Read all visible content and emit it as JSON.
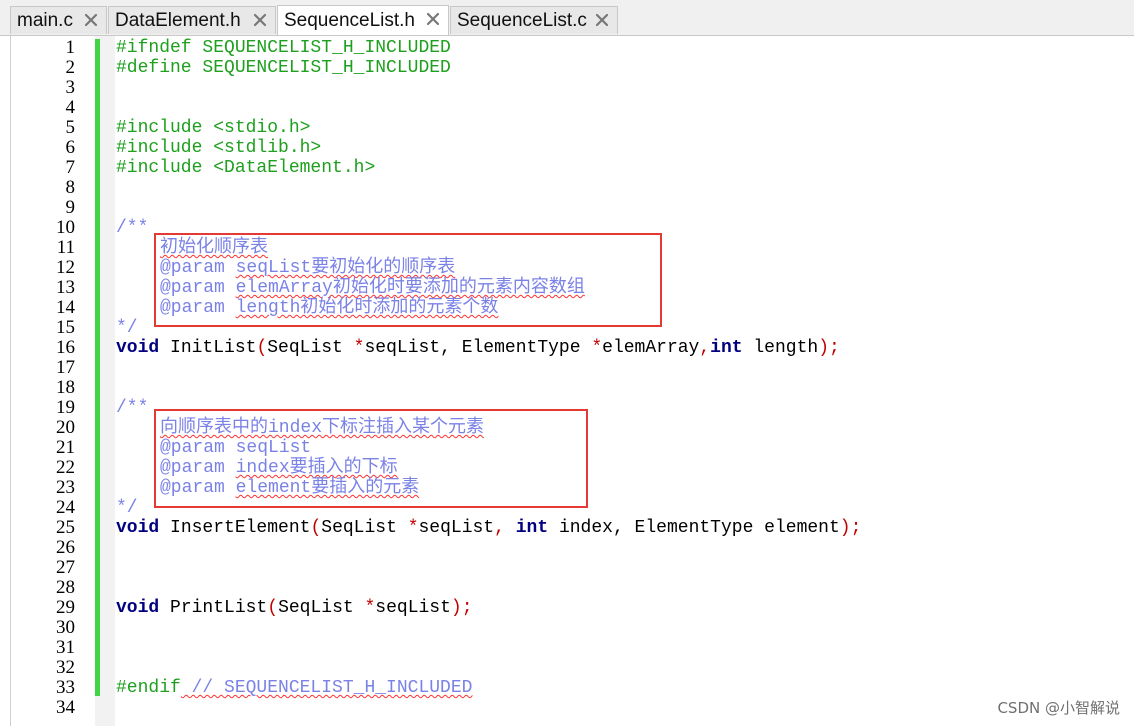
{
  "tabs": [
    {
      "label": "main.c",
      "active": false
    },
    {
      "label": "DataElement.h",
      "active": false
    },
    {
      "label": "SequenceList.h",
      "active": true
    },
    {
      "label": "SequenceList.c",
      "active": false
    }
  ],
  "tab_close_icon": "close-icon",
  "editor": {
    "lines": [
      {
        "n": "1"
      },
      {
        "n": "2"
      },
      {
        "n": "3"
      },
      {
        "n": "4"
      },
      {
        "n": "5"
      },
      {
        "n": "6"
      },
      {
        "n": "7"
      },
      {
        "n": "8"
      },
      {
        "n": "9"
      },
      {
        "n": "10"
      },
      {
        "n": "11"
      },
      {
        "n": "12"
      },
      {
        "n": "13"
      },
      {
        "n": "14"
      },
      {
        "n": "15"
      },
      {
        "n": "16"
      },
      {
        "n": "17"
      },
      {
        "n": "18"
      },
      {
        "n": "19"
      },
      {
        "n": "20"
      },
      {
        "n": "21"
      },
      {
        "n": "22"
      },
      {
        "n": "23"
      },
      {
        "n": "24"
      },
      {
        "n": "25"
      },
      {
        "n": "26"
      },
      {
        "n": "27"
      },
      {
        "n": "28"
      },
      {
        "n": "29"
      },
      {
        "n": "30"
      },
      {
        "n": "31"
      },
      {
        "n": "32"
      },
      {
        "n": "33"
      },
      {
        "n": "34"
      }
    ],
    "code": {
      "l1": "#ifndef SEQUENCELIST_H_INCLUDED",
      "l2": "#define SEQUENCELIST_H_INCLUDED",
      "l5": "#include <stdio.h>",
      "l6": "#include <stdlib.h>",
      "l7": "#include <DataElement.h>",
      "l10": "/**",
      "l11": "初始化顺序表",
      "l12_tag": "@param ",
      "l12_txt": "seqList要初始化的顺序表",
      "l13_tag": "@param ",
      "l13_txt": "elemArray初始化时要添加的元素内容数组",
      "l14_tag": "@param ",
      "l14_txt": "length初始化时添加的元素个数",
      "l15": "*/",
      "l16_kw1": "void",
      "l16_name": " InitList",
      "l16_p1": "(",
      "l16_a1": "SeqList ",
      "l16_st1": "*",
      "l16_a2": "seqList, ElementType ",
      "l16_st2": "*",
      "l16_a3": "elemArray",
      "l16_cm": ",",
      "l16_kw2": "int",
      "l16_a4": " length",
      "l16_p2": ");",
      "l19": "/**",
      "l20": "向顺序表中的index下标注插入某个元素",
      "l21_tag": "@param ",
      "l21_txt": "seqList",
      "l22_tag": "@param ",
      "l22_txt": "index要插入的下标",
      "l23_tag": "@param ",
      "l23_txt": "element要插入的元素",
      "l24": "*/",
      "l25_kw1": "void",
      "l25_name": " InsertElement",
      "l25_p1": "(",
      "l25_a1": "SeqList ",
      "l25_st1": "*",
      "l25_a2": "seqList",
      "l25_cm1": ", ",
      "l25_kw2": "int",
      "l25_a3": " index, ElementType element",
      "l25_p2": ");",
      "l29_kw1": "void",
      "l29_name": " PrintList",
      "l29_p1": "(",
      "l29_a1": "SeqList ",
      "l29_st1": "*",
      "l29_a2": "seqList",
      "l29_p2": ");",
      "l33_pp": "#endif",
      "l33_cm": " // SEQUENCELIST_H_INCLUDED"
    }
  },
  "watermark": "CSDN @小智解说",
  "colors": {
    "preprocessor": "#1ea01e",
    "doc_comment": "#7b82e6",
    "keyword": "#000080",
    "operator": "#c00000",
    "change_bar": "#41d444",
    "highlight_box": "#e53935"
  }
}
